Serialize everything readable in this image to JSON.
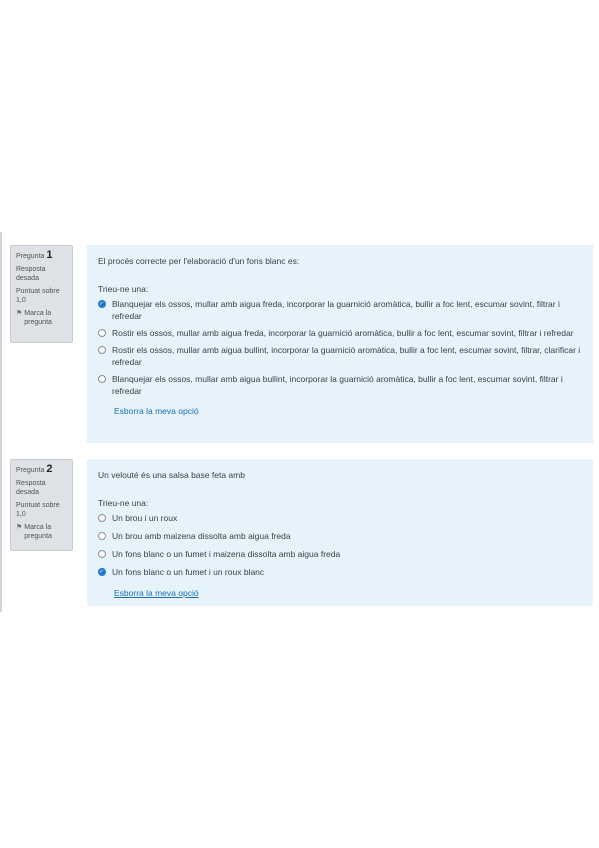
{
  "questions": [
    {
      "number_prefix": "Pregunta",
      "number": "1",
      "state": "Resposta desada",
      "grade": "Puntuat sobre 1,0",
      "flag_label": "Marca la pregunta",
      "flag_icon": "flag-icon",
      "text": "El procés correcte per l'elaboració d'un fons blanc es:",
      "prompt": "Trieu-ne una:",
      "answers": [
        {
          "label": "Blanquejar els ossos, mullar amb aigua freda, incorporar la guarnició aromàtica, bullir a foc lent, escumar sovint, filtrar i refredar",
          "checked": true
        },
        {
          "label": "Rostir els ossos, mullar amb aigua freda, incorporar la guarnició aromàtica, bullir a foc lent, escumar sovint, filtrar i refredar",
          "checked": false
        },
        {
          "label": "Rostir els ossos, mullar amb aigua bullint, incorporar la guarnició aromàtica, bullir a foc lent, escumar sovint, filtrar, clarificar i refredar",
          "checked": false
        },
        {
          "label": "Blanquejar els ossos, mullar amb aigua bullint, incorporar la guarnició aromàtica, bullir a foc lent, escumar sovint, filtrar i refredar",
          "checked": false
        }
      ],
      "clear_label": "Esborra la meva opció"
    },
    {
      "number_prefix": "Pregunta",
      "number": "2",
      "state": "Resposta desada",
      "grade": "Puntuat sobre 1,0",
      "flag_label": "Marca la pregunta",
      "flag_icon": "flag-icon",
      "text": "Un velouté és una salsa base feta amb",
      "prompt": "Trieu-ne una:",
      "answers": [
        {
          "label": "Un brou i un roux",
          "checked": false
        },
        {
          "label": "Un brou amb maizena dissolta amb aigua freda",
          "checked": false
        },
        {
          "label": "Un fons blanc o un fumet i maizena dissolta amb aigua freda",
          "checked": false
        },
        {
          "label": "Un fons blanc o un fumet i un roux blanc",
          "checked": true
        }
      ],
      "clear_label": "Esborra la meva opció"
    }
  ],
  "colors": {
    "accent": "#1a73c9",
    "content_bg": "#e6f3fa",
    "info_bg": "#dee2e6",
    "link": "#1a6fb5"
  }
}
